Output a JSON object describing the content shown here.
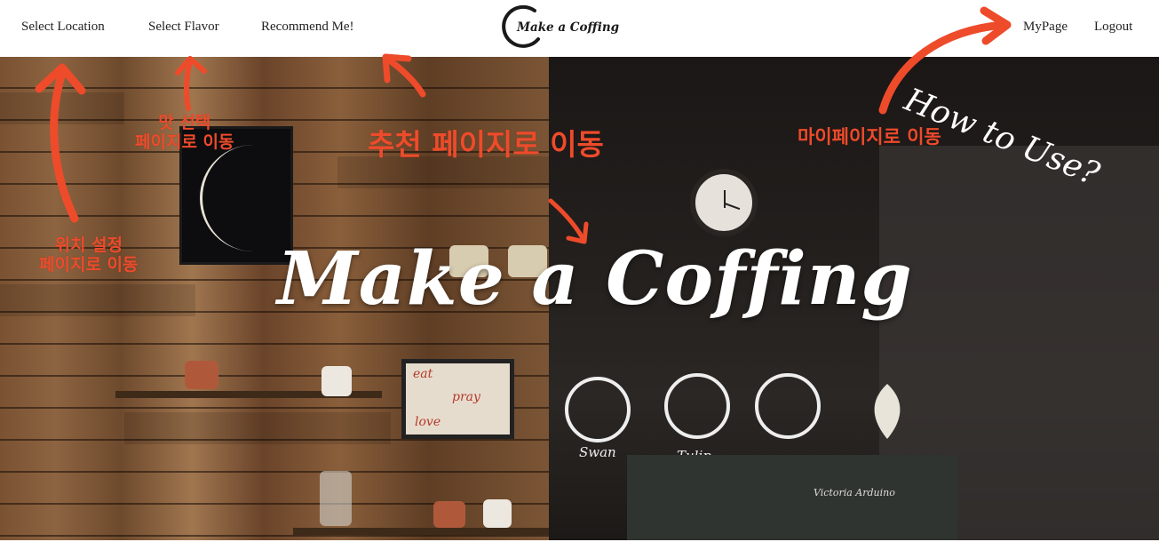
{
  "nav": {
    "left_links": [
      "Select Location",
      "Select Flavor",
      "Recommend Me!"
    ],
    "logo_text": "Make a Coffing",
    "right_links": [
      "MyPage",
      "Logout"
    ]
  },
  "hero": {
    "title": "Make a Coffing",
    "how_to": "How to Use?",
    "board_words": [
      "eat",
      "pray",
      "love"
    ],
    "latte_labels": [
      "Swan",
      "Tulip"
    ],
    "machine_label": "Victoria Arduino"
  },
  "annotations": {
    "location_line1": "위치 설정",
    "location_line2": "페이지로 이동",
    "flavor_line1": "맛 선택",
    "flavor_line2": "페이지로 이동",
    "recommend": "추천 페이지로 이동",
    "mypage": "마이페이지로 이동"
  },
  "colors": {
    "annotation": "#ee4b2b",
    "nav_text": "#222222",
    "hero_text": "#ffffff"
  }
}
